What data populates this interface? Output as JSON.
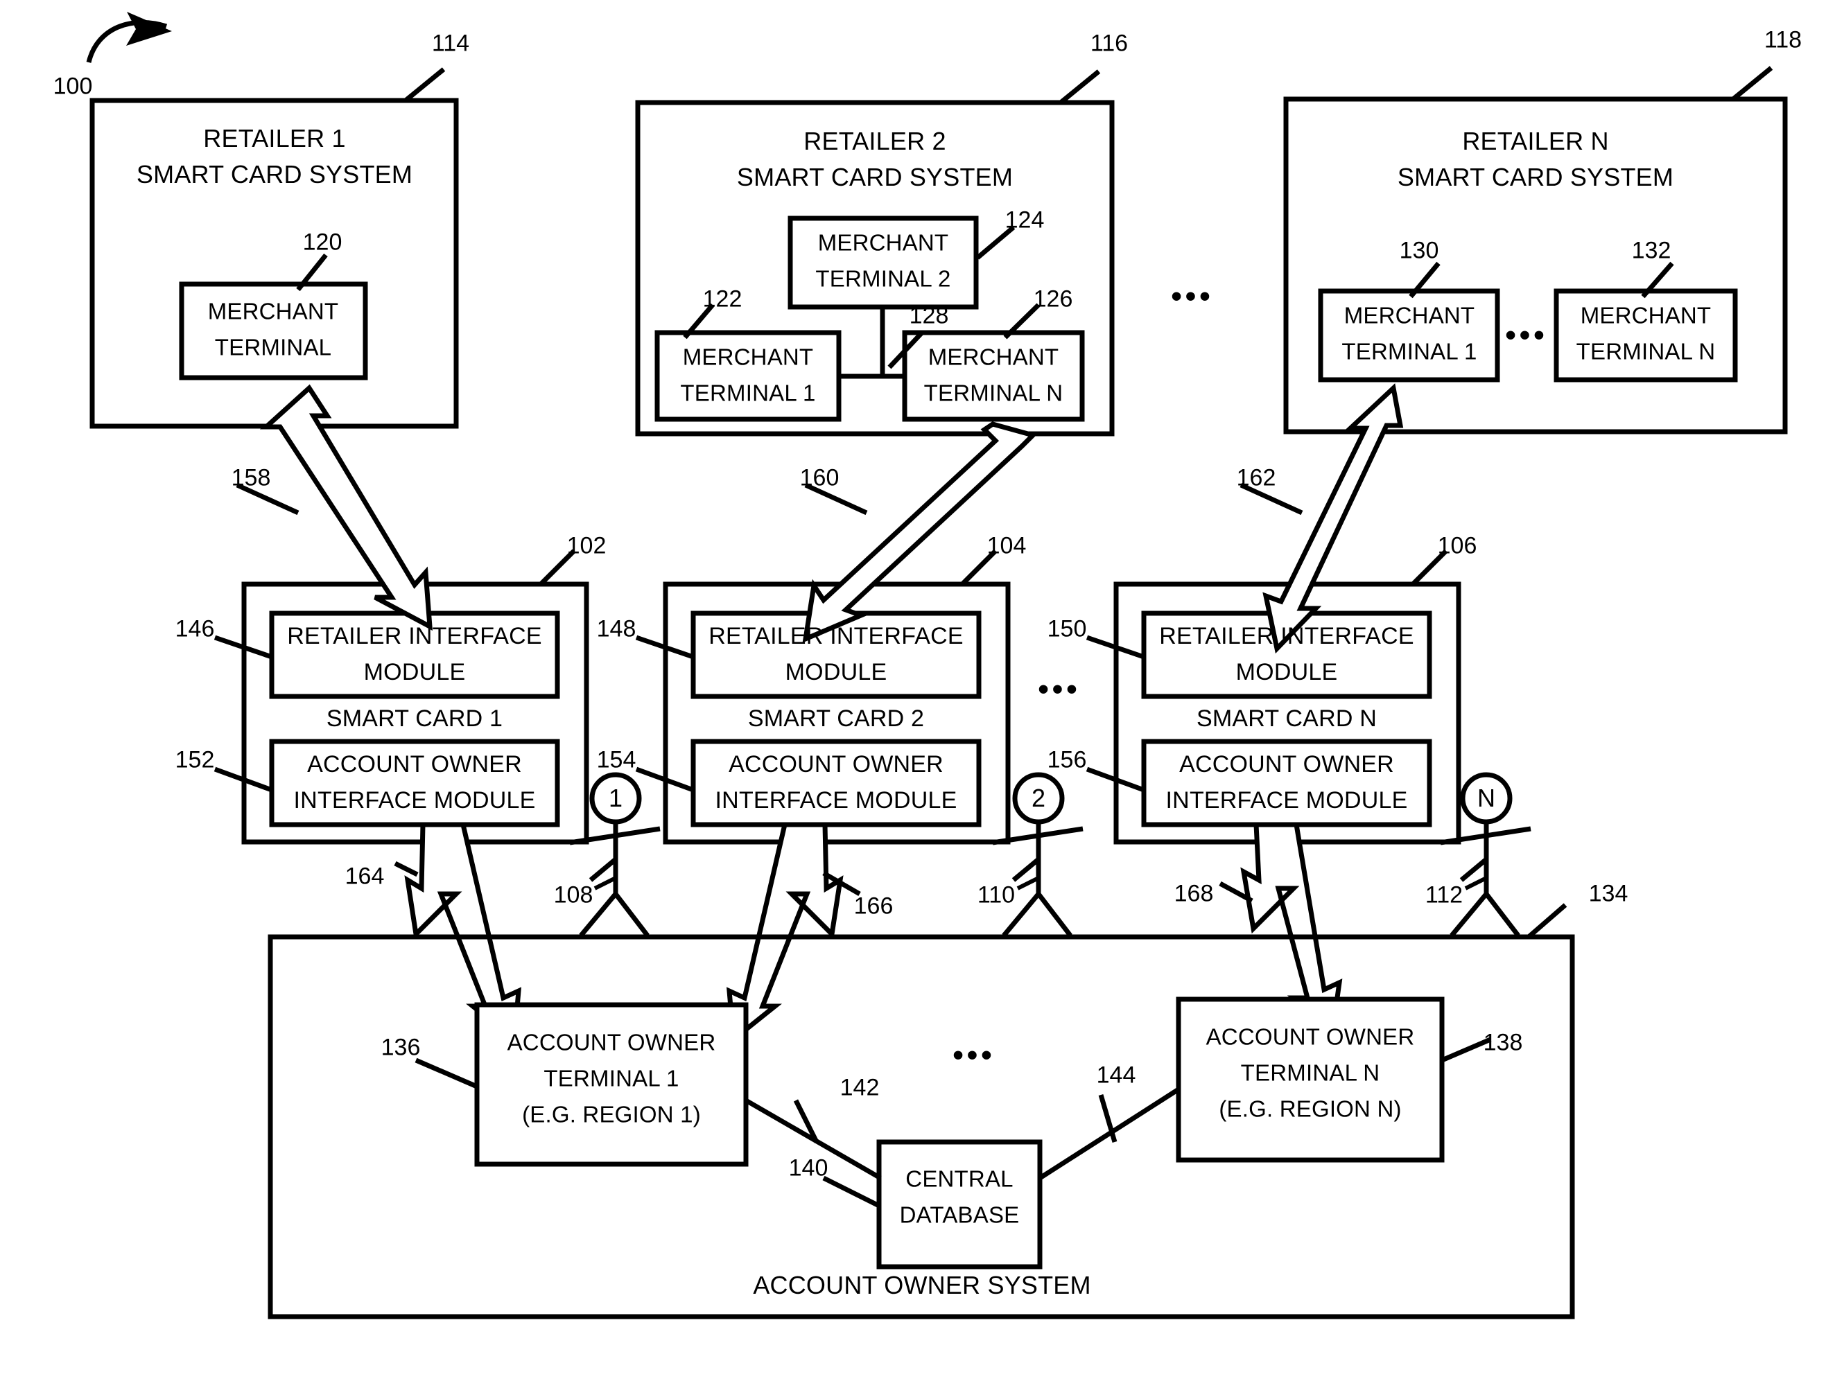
{
  "figure": {
    "figure_ref": "100",
    "retailer_systems": [
      {
        "ref": "114",
        "title_line1": "RETAILER 1",
        "title_line2": "SMART CARD SYSTEM",
        "terminals": [
          {
            "ref": "120",
            "line1": "MERCHANT",
            "line2": "TERMINAL"
          }
        ]
      },
      {
        "ref": "116",
        "title_line1": "RETAILER 2",
        "title_line2": "SMART CARD SYSTEM",
        "terminals": [
          {
            "ref": "124",
            "line1": "MERCHANT",
            "line2": "TERMINAL 2"
          },
          {
            "ref": "122",
            "line1": "MERCHANT",
            "line2": "TERMINAL 1"
          },
          {
            "ref": "126",
            "line1": "MERCHANT",
            "line2": "TERMINAL N"
          }
        ],
        "bus_ref": "128"
      },
      {
        "ref": "118",
        "title_line1": "RETAILER N",
        "title_line2": "SMART CARD SYSTEM",
        "terminals": [
          {
            "ref": "130",
            "line1": "MERCHANT",
            "line2": "TERMINAL 1"
          },
          {
            "ref": "132",
            "line1": "MERCHANT",
            "line2": "TERMINAL N"
          }
        ],
        "terminal_gap_ellipsis": "•••"
      }
    ],
    "retailer_gap_ellipsis": "•••",
    "smart_cards": [
      {
        "ref": "102",
        "name": "SMART CARD 1",
        "retailer_module": {
          "ref": "146",
          "line1": "RETAILER INTERFACE",
          "line2": "MODULE"
        },
        "owner_module": {
          "ref": "152",
          "line1": "ACCOUNT OWNER",
          "line2": "INTERFACE MODULE"
        }
      },
      {
        "ref": "104",
        "name": "SMART CARD 2",
        "retailer_module": {
          "ref": "148",
          "line1": "RETAILER INTERFACE",
          "line2": "MODULE"
        },
        "owner_module": {
          "ref": "154",
          "line1": "ACCOUNT OWNER",
          "line2": "INTERFACE MODULE"
        }
      },
      {
        "ref": "106",
        "name": "SMART CARD N",
        "retailer_module": {
          "ref": "150",
          "line1": "RETAILER INTERFACE",
          "line2": "MODULE"
        },
        "owner_module": {
          "ref": "156",
          "line1": "ACCOUNT OWNER",
          "line2": "INTERFACE MODULE"
        }
      }
    ],
    "smart_card_gap_ellipsis": "•••",
    "actors": [
      {
        "ref": "108",
        "head_label": "1"
      },
      {
        "ref": "110",
        "head_label": "2"
      },
      {
        "ref": "112",
        "head_label": "N"
      }
    ],
    "retailer_links": [
      {
        "ref": "158"
      },
      {
        "ref": "160"
      },
      {
        "ref": "162"
      }
    ],
    "owner_links": [
      {
        "ref": "164"
      },
      {
        "ref": "166"
      },
      {
        "ref": "168"
      }
    ],
    "account_owner_system": {
      "ref": "134",
      "label": "ACCOUNT OWNER SYSTEM",
      "terminals": [
        {
          "ref": "136",
          "line1": "ACCOUNT OWNER",
          "line2": "TERMINAL 1",
          "line3": "(E.G. REGION 1)"
        },
        {
          "ref": "138",
          "line1": "ACCOUNT OWNER",
          "line2": "TERMINAL N",
          "line3": "(E.G. REGION N)"
        }
      ],
      "terminal_gap_ellipsis": "•••",
      "database": {
        "ref": "140",
        "line1": "CENTRAL",
        "line2": "DATABASE"
      },
      "db_links": [
        {
          "ref": "142"
        },
        {
          "ref": "144"
        }
      ]
    }
  }
}
